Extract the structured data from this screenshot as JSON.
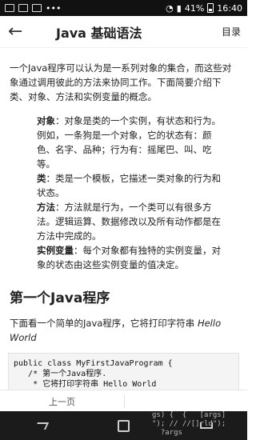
{
  "status_bar": {
    "battery": "41%",
    "time": "16:40"
  },
  "app_bar": {
    "back": "←",
    "title": "Java 基础语法",
    "menu": "目录"
  },
  "intro": "一个Java程序可以认为是一系列对象的集合，而这些对象通过调用彼此的方法来协同工作。下面简要介绍下类、对象、方法和实例变量的概念。",
  "definitions": [
    {
      "term": "对象",
      "desc": "：对象是类的一个实例，有状态和行为。例如，一条狗是一个对象，它的状态有：颜色、名字、品种；行为有：摇尾巴、叫、吃等。"
    },
    {
      "term": "类",
      "desc": "：类是一个模板，它描述一类对象的行为和状态。"
    },
    {
      "term": "方法",
      "desc": "：方法就是行为，一个类可以有很多方法。逻辑运算、数据修改以及所有动作都是在方法中完成的。"
    },
    {
      "term": "实例变量",
      "desc": "：每个对象都有独特的实例变量，对象的状态由这些实例变量的值决定。"
    }
  ],
  "section": {
    "title": "第一个Java程序",
    "lead": "下面看一个简单的Java程序，它将打印字符串 ",
    "lead_italic": "Hello World"
  },
  "code": "public class MyFirstJavaProgram {\n   /* 第一个Java程序.\n    * 它将打印字符串 Hello World\n    */\n    public static void main(String []args) {\n       System.out.println(\"Hello World\"); // 打\n    }\n}",
  "bottom_nav": {
    "prev": "上一页"
  },
  "ghost_text": "gs) {  {   [args]\n\"); // //[]rld\");\n  ?args"
}
